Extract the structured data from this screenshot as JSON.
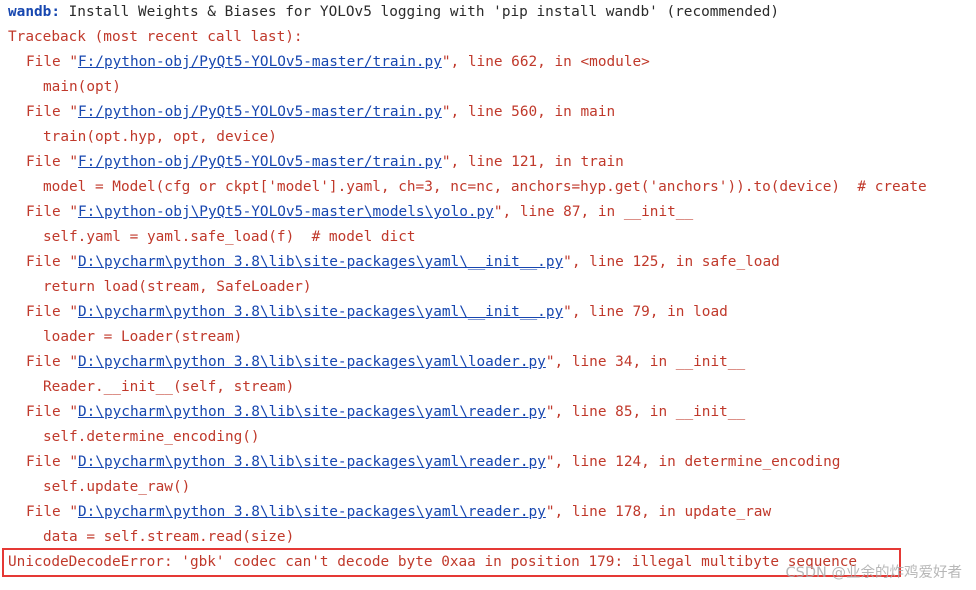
{
  "colors": {
    "error_text": "#c0392b",
    "link": "#1747b0",
    "highlight_border": "#e53935",
    "background": "#ffffff"
  },
  "wandb": {
    "label": "wandb:",
    "message": " Install Weights & Biases for YOLOv5 logging with 'pip install wandb' (recommended)"
  },
  "traceback_header": "Traceback (most recent call last):",
  "frames": [
    {
      "prefix": "File \"",
      "path": "F:/python-obj/PyQt5-YOLOv5-master/train.py",
      "suffix": "\", line 662, in <module>",
      "code": "main(opt)"
    },
    {
      "prefix": "File \"",
      "path": "F:/python-obj/PyQt5-YOLOv5-master/train.py",
      "suffix": "\", line 560, in main",
      "code": "train(opt.hyp, opt, device)"
    },
    {
      "prefix": "File \"",
      "path": "F:/python-obj/PyQt5-YOLOv5-master/train.py",
      "suffix": "\", line 121, in train",
      "code": "model = Model(cfg or ckpt['model'].yaml, ch=3, nc=nc, anchors=hyp.get('anchors')).to(device)  # create"
    },
    {
      "prefix": "File \"",
      "path": "F:\\python-obj\\PyQt5-YOLOv5-master\\models\\yolo.py",
      "suffix": "\", line 87, in __init__",
      "code": "self.yaml = yaml.safe_load(f)  # model dict"
    },
    {
      "prefix": "File \"",
      "path": "D:\\pycharm\\python 3.8\\lib\\site-packages\\yaml\\__init__.py",
      "suffix": "\", line 125, in safe_load",
      "code": "return load(stream, SafeLoader)"
    },
    {
      "prefix": "File \"",
      "path": "D:\\pycharm\\python 3.8\\lib\\site-packages\\yaml\\__init__.py",
      "suffix": "\", line 79, in load",
      "code": "loader = Loader(stream)"
    },
    {
      "prefix": "File \"",
      "path": "D:\\pycharm\\python 3.8\\lib\\site-packages\\yaml\\loader.py",
      "suffix": "\", line 34, in __init__",
      "code": "Reader.__init__(self, stream)"
    },
    {
      "prefix": "File \"",
      "path": "D:\\pycharm\\python 3.8\\lib\\site-packages\\yaml\\reader.py",
      "suffix": "\", line 85, in __init__",
      "code": "self.determine_encoding()"
    },
    {
      "prefix": "File \"",
      "path": "D:\\pycharm\\python 3.8\\lib\\site-packages\\yaml\\reader.py",
      "suffix": "\", line 124, in determine_encoding",
      "code": "self.update_raw()"
    },
    {
      "prefix": "File \"",
      "path": "D:\\pycharm\\python 3.8\\lib\\site-packages\\yaml\\reader.py",
      "suffix": "\", line 178, in update_raw",
      "code": "data = self.stream.read(size)"
    }
  ],
  "error_line": "UnicodeDecodeError: 'gbk' codec can't decode byte 0xaa in position 179: illegal multibyte sequence",
  "watermark": "CSDN @业余的炸鸡爱好者"
}
